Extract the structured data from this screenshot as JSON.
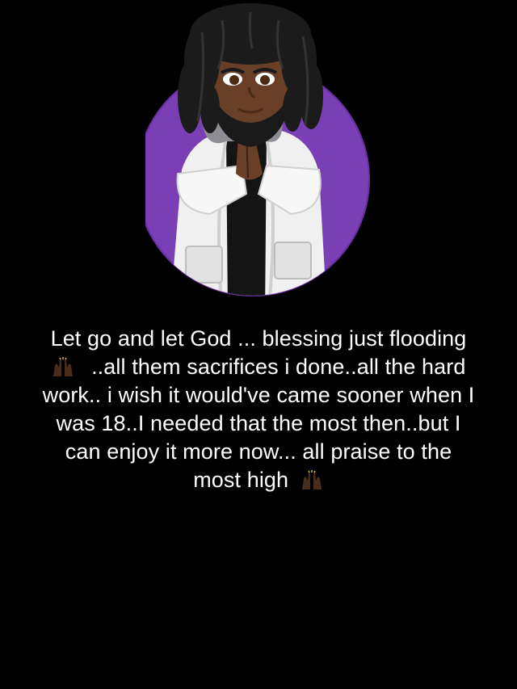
{
  "story": {
    "avatar_icon": "bitmoji-avatar-praying-hands",
    "emoji_icon": "raising-hands-emoji-dark-skin",
    "circle_color": "#7b3fb5",
    "background_color": "#000000",
    "text_color": "#ffffff",
    "lines": [
      {
        "before": "Let go and let God ... blessing just flooding",
        "emoji": false,
        "after": ""
      },
      {
        "before": "",
        "emoji": true,
        "after": "..all them sacrifices i done..all the hard"
      },
      {
        "before": "work.. i wish it would've came sooner when I",
        "emoji": false,
        "after": ""
      },
      {
        "before": "was 18..I needed that the most then..but I",
        "emoji": false,
        "after": ""
      },
      {
        "before": "can enjoy it more now... all praise to the",
        "emoji": false,
        "after": ""
      },
      {
        "before": "most high",
        "emoji": true,
        "after": ""
      }
    ]
  }
}
